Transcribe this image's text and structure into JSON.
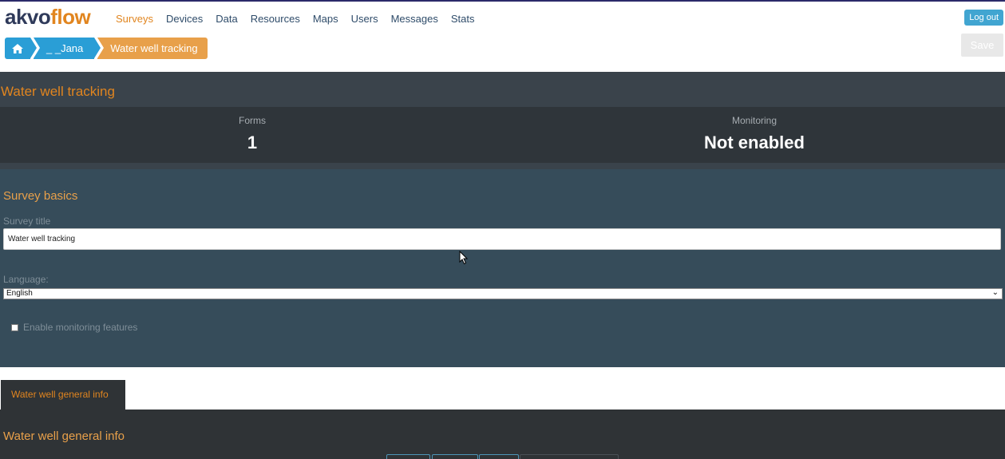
{
  "logo": {
    "part1": "akvo",
    "part2": "flow"
  },
  "nav": {
    "items": [
      "Surveys",
      "Devices",
      "Data",
      "Resources",
      "Maps",
      "Users",
      "Messages",
      "Stats"
    ],
    "active": "Surveys"
  },
  "header": {
    "logout_label": "Log out",
    "save_label": "Save"
  },
  "breadcrumb": {
    "home_icon": "home-icon",
    "folder": "_ _Jana",
    "current": "Water well tracking"
  },
  "survey": {
    "title": "Water well tracking",
    "stats": {
      "forms_label": "Forms",
      "forms_value": "1",
      "monitoring_label": "Monitoring",
      "monitoring_value": "Not enabled"
    }
  },
  "basics": {
    "heading": "Survey basics",
    "title_label": "Survey title",
    "title_value": "Water well tracking",
    "language_label": "Language:",
    "language_value": "English",
    "monitoring_checkbox_label": "Enable monitoring features",
    "monitoring_checked": false
  },
  "forms": {
    "tab_label": "Water well general info",
    "section_heading": "Water well general info"
  },
  "colors": {
    "accent": "#e1851f",
    "primary": "#2a9ed6",
    "band": "#364c5a",
    "dark": "#2f3336"
  }
}
